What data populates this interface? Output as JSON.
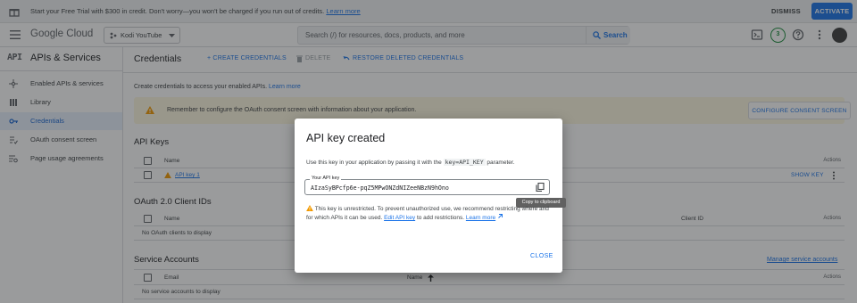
{
  "banner": {
    "message": "Start your Free Trial with $300 in credit. Don't worry—you won't be charged if you run out of credits.",
    "learn_more": "Learn more",
    "dismiss": "DISMISS",
    "activate": "ACTIVATE"
  },
  "header": {
    "logo_text": "Google Cloud",
    "project_name": "Kodi YouTube",
    "search_placeholder": "Search (/) for resources, docs, products, and more",
    "search_button": "Search",
    "notifications_count": "3"
  },
  "sidebar": {
    "api_badge": "API",
    "title": "APIs & Services",
    "items": [
      {
        "label": "Enabled APIs & services",
        "icon": "hub-icon"
      },
      {
        "label": "Library",
        "icon": "library-icon"
      },
      {
        "label": "Credentials",
        "icon": "key-icon",
        "active": true
      },
      {
        "label": "OAuth consent screen",
        "icon": "consent-icon"
      },
      {
        "label": "Page usage agreements",
        "icon": "settings-list-icon"
      }
    ]
  },
  "main": {
    "title": "Credentials",
    "toolbar": {
      "create": "+ CREATE CREDENTIALS",
      "delete": "DELETE",
      "restore": "RESTORE DELETED CREDENTIALS"
    },
    "intro": "Create credentials to access your enabled APIs.",
    "intro_link": "Learn more",
    "warning": "Remember to configure the OAuth consent screen with information about your application.",
    "consent_button": "CONFIGURE CONSENT SCREEN",
    "api_keys": {
      "title": "API Keys",
      "columns": [
        "Name",
        "Actions"
      ],
      "rows": [
        {
          "name": "API key 1",
          "action": "SHOW KEY"
        }
      ]
    },
    "oauth": {
      "title": "OAuth 2.0 Client IDs",
      "columns": [
        "Name",
        "Client ID",
        "Actions"
      ],
      "empty": "No OAuth clients to display"
    },
    "service_accounts": {
      "title": "Service Accounts",
      "manage_link": "Manage service accounts",
      "columns": [
        "Email",
        "Name",
        "Actions"
      ],
      "empty": "No service accounts to display"
    }
  },
  "modal": {
    "title": "API key created",
    "desc_pre": "Use this key in your application by passing it with the",
    "desc_code": "key=API_KEY",
    "desc_post": "parameter.",
    "field_label": "Your API key",
    "api_key": "AIzaSyBPcfp6e-pqZ5MPwONZdNIZeeNBzN9hOno",
    "tooltip": "Copy to clipboard",
    "warning_text": "This key is unrestricted. To prevent unauthorized use, we recommend restricting where and for which APIs it can be used.",
    "edit_link": "Edit API key",
    "warning_tail": "to add restrictions.",
    "learn_more": "Learn more",
    "close": "CLOSE"
  },
  "colors": {
    "accent": "#1a73e8",
    "warning": "#f29900",
    "success": "#1e8e3e"
  }
}
